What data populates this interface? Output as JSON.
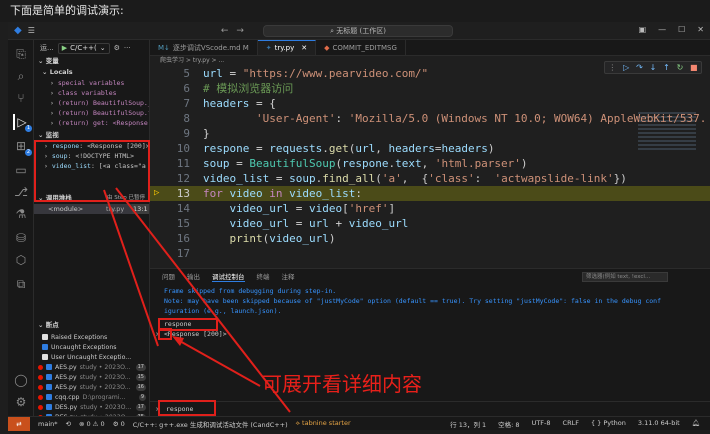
{
  "caption": "下面是简单的调试演示:",
  "titlebar": {
    "nav_back": "←",
    "nav_fwd": "→",
    "command_center": "无标题 (工作区)"
  },
  "sidebar": {
    "title": "运...",
    "run_config": "C/C++(",
    "variables_title": "变量",
    "locals_title": "Locals",
    "locals": [
      {
        "label": "special variables"
      },
      {
        "label": "class variables"
      },
      {
        "label": "(return) BeautifulSoup._"
      },
      {
        "label": "(return) BeautifulSoup.fi"
      },
      {
        "label": "(return) get: <Response"
      }
    ],
    "watch_title": "监视",
    "watch": [
      {
        "name": "respone",
        "value": "<Response [200]>"
      },
      {
        "name": "soup",
        "value": "<!DOCTYPE HTML>"
      },
      {
        "name": "video_list",
        "value": "[<a class=\"a"
      }
    ],
    "callstack_title": "调用堆栈",
    "callstack_status": "由 Step 已暂停",
    "frame_name": "<module>",
    "frame_file": "try.py",
    "frame_pos": "13:1",
    "breakpoints_title": "断点",
    "exception_options": [
      {
        "label": "Raised Exceptions",
        "checked": false
      },
      {
        "label": "Uncaught Exceptions",
        "checked": true
      },
      {
        "label": "User Uncaught Exceptio...",
        "checked": false
      }
    ],
    "breakpoints": [
      {
        "file": "AES.py",
        "path": "study • 2023O...",
        "count": "17"
      },
      {
        "file": "AES.py",
        "path": "study • 2023O...",
        "count": "15"
      },
      {
        "file": "AES.py",
        "path": "study • 2023O...",
        "count": "16"
      },
      {
        "file": "cqq.cpp",
        "path": "D:\\programi...",
        "count": "9"
      },
      {
        "file": "DES.py",
        "path": "study • 2023O...",
        "count": "17"
      },
      {
        "file": "DES.py",
        "path": "study • 2023O...",
        "count": "15"
      }
    ]
  },
  "editor": {
    "tabs": [
      {
        "label": "逐步调试VScode.md M",
        "icon": "markdown-icon",
        "active": false
      },
      {
        "label": "try.py",
        "icon": "python-icon",
        "active": true
      },
      {
        "label": "COMMIT_EDITMSG",
        "icon": "git-icon",
        "active": false
      }
    ],
    "breadcrumbs": "爬虫学习 > try.py > ...",
    "line_numbers": [
      "5",
      "6",
      "7",
      "8",
      "9",
      "10",
      "11",
      "12",
      "13",
      "14",
      "15",
      "16",
      "17"
    ],
    "current_line": "13"
  },
  "panel": {
    "tabs": [
      "问题",
      "输出",
      "调试控制台",
      "终端",
      "注释"
    ],
    "active_tab": "调试控制台",
    "filter_placeholder": "筛选器(例如 text, !excl...",
    "out1": "Frame skipped from debugging during step-in.",
    "out2": "Note: may have been skipped because of \"justMyCode\" option (default == true). Try setting \"justMyCode\": false in the debug conf",
    "out3": "iguration (e.g., launch.json).",
    "eval_expr": "respone",
    "eval_result": "<Response [200]>",
    "input_value": "respone"
  },
  "annotation": "可展开看详细内容",
  "statusbar": {
    "branch": "main*",
    "sync": "⟲",
    "problems": "⊗ 0 ⚠ 0",
    "debug": "⚙ 0",
    "launch": "C/C++: g++.exe 生成和调试活动文件 (CandC++)",
    "tabnine": "⟡ tabnine starter",
    "position": "行 13，列 1",
    "spaces": "空格: 8",
    "encoding": "UTF-8",
    "eol": "CRLF",
    "language": "{ } Python",
    "interpreter": "3.11.0 64-bit"
  }
}
